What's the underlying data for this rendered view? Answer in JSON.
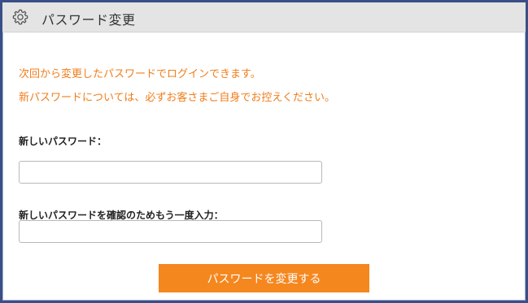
{
  "header": {
    "icon": "gear-icon",
    "title": "パスワード変更"
  },
  "notice": {
    "line1": "次回から変更したパスワードでログインできます。",
    "line2": "新パスワードについては、必ずお客さまご自身でお控えください。",
    "color": "#f07d1b"
  },
  "form": {
    "new_password_label": "新しいパスワード：",
    "new_password_value": "",
    "confirm_password_label": "新しいパスワードを確認のためもう一度入力：",
    "confirm_password_value": ""
  },
  "submit": {
    "label": "パスワードを変更する",
    "color": "#f5871f"
  },
  "frame": {
    "border_color": "#3a4f86"
  }
}
